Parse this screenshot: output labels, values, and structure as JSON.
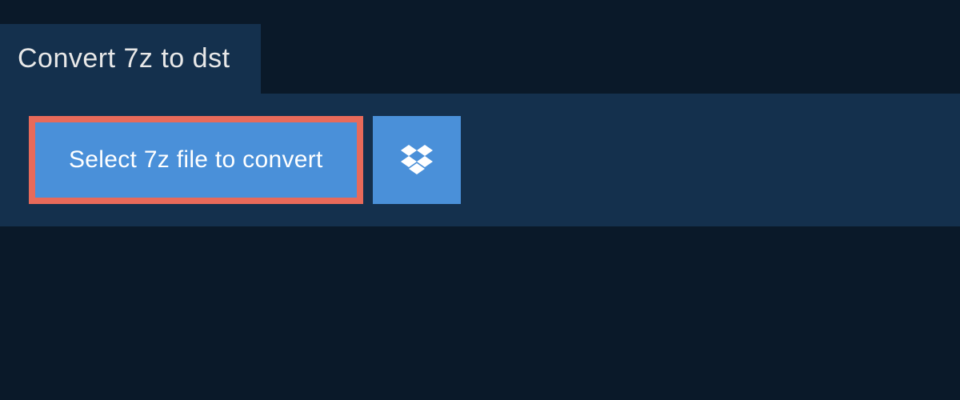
{
  "tab": {
    "title": "Convert 7z to dst"
  },
  "main": {
    "selectButtonLabel": "Select 7z file to convert"
  },
  "colors": {
    "background": "#0a1929",
    "panel": "#14304d",
    "buttonBlue": "#4a90d9",
    "highlightBorder": "#e86a5a",
    "text": "#e8e8e8"
  }
}
